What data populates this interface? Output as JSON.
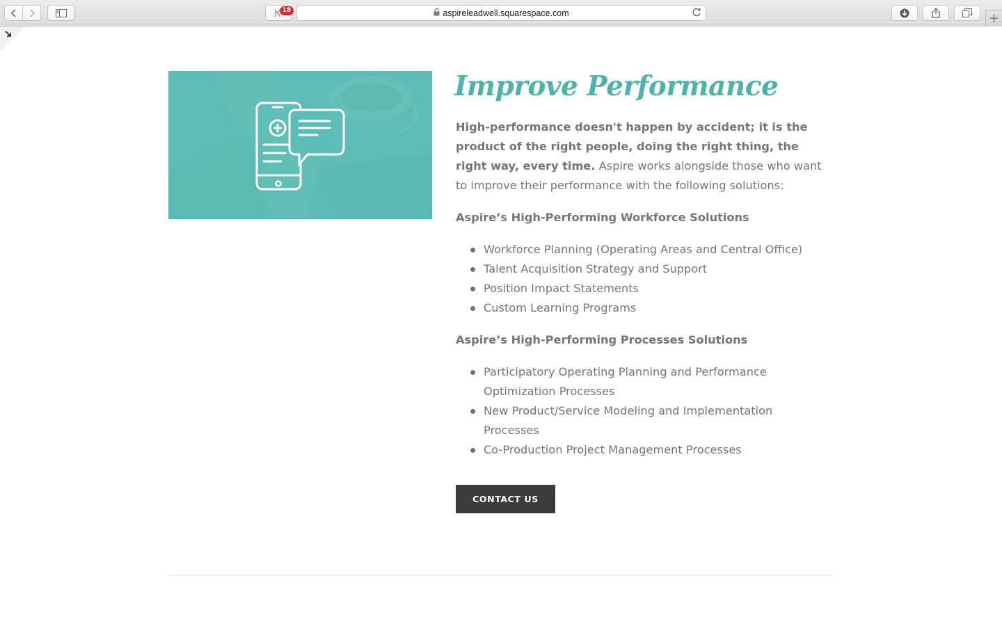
{
  "browser": {
    "url": "aspireleadwell.squarespace.com",
    "extension_badge": "18",
    "icons": {
      "back": "chevron-left-icon",
      "forward": "chevron-right-icon",
      "sidebar": "sidebar-icon",
      "lock": "lock-icon",
      "reload": "reload-icon",
      "download": "download-icon",
      "share": "share-icon",
      "tabs": "tabs-icon",
      "new_tab": "plus-icon"
    }
  },
  "section": {
    "title": "Improve Performance",
    "intro_bold": "High-performance doesn't happen by accident; it is the product of the right people, doing the right thing, the right way, every time.",
    "intro_rest": " Aspire works alongside those who want to improve their performance with the following solutions:",
    "workforce_heading": "Aspire’s High-Performing Workforce Solutions",
    "workforce_items": [
      "Workforce Planning (Operating Areas and Central Office)",
      "Talent Acquisition Strategy and Support",
      "Position Impact Statements",
      "Custom Learning Programs"
    ],
    "processes_heading": "Aspire’s High-Performing Processes Solutions",
    "processes_items": [
      "Participatory Operating Planning and Performance Optimization Processes",
      "New Product/Service Modeling and Implementation Processes",
      "Co-Production Project Management Processes"
    ],
    "contact_label": "CONTACT US"
  },
  "colors": {
    "accent": "#4eb3ab",
    "image_teal": "#5dbcb5",
    "body_text": "#7a7471",
    "button": "#3c3c3c"
  }
}
